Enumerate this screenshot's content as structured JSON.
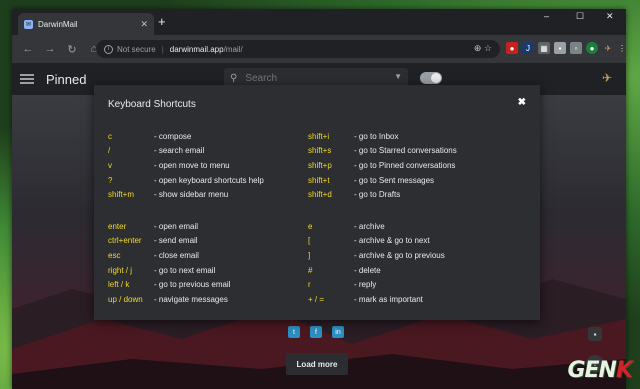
{
  "browser": {
    "tab_title": "DarwinMail",
    "new_tab": "+",
    "window_controls": [
      "–",
      "☐",
      "✕"
    ],
    "address": {
      "security": "Not secure",
      "host": "darwinmail.app",
      "path": "/mail/"
    },
    "extensions": [
      "J"
    ]
  },
  "app": {
    "title": "Pinned",
    "search_placeholder": "Search"
  },
  "modal": {
    "title": "Keyboard Shortcuts",
    "close": "✖",
    "left_top": [
      {
        "key": "c",
        "desc": "- compose"
      },
      {
        "key": "/",
        "desc": "- search email"
      },
      {
        "key": "v",
        "desc": "- open move to menu"
      },
      {
        "key": "?",
        "desc": "- open keyboard shortcuts help"
      },
      {
        "key": "shift+m",
        "desc": "- show sidebar menu"
      }
    ],
    "right_top": [
      {
        "key": "shift+i",
        "desc": "- go to Inbox"
      },
      {
        "key": "shift+s",
        "desc": "- go to Starred conversations"
      },
      {
        "key": "shift+p",
        "desc": "- go to Pinned conversations"
      },
      {
        "key": "shift+t",
        "desc": "- go to Sent messages"
      },
      {
        "key": "shift+d",
        "desc": "- go to Drafts"
      }
    ],
    "left_bottom": [
      {
        "key": "enter",
        "desc": "- open email"
      },
      {
        "key": "ctrl+enter",
        "desc": "- send email"
      },
      {
        "key": "esc",
        "desc": "- close email"
      },
      {
        "key": "right / j",
        "desc": "- go to next email"
      },
      {
        "key": "left / k",
        "desc": "- go to previous email"
      },
      {
        "key": "up / down",
        "desc": "- navigate messages"
      }
    ],
    "right_bottom": [
      {
        "key": "e",
        "desc": "- archive"
      },
      {
        "key": "[",
        "desc": "- archive & go to next"
      },
      {
        "key": "]",
        "desc": "- archive & go to previous"
      },
      {
        "key": "#",
        "desc": "- delete"
      },
      {
        "key": "r",
        "desc": "- reply"
      },
      {
        "key": "+ / =",
        "desc": "- mark as important"
      }
    ]
  },
  "footer": {
    "social": [
      "t",
      "f",
      "in"
    ],
    "load_more": "Load more"
  },
  "watermark": {
    "main": "GEN",
    "accent": "K"
  },
  "colors": {
    "shortcut_key": "#f1d92d",
    "modal_bg": "#2d2e31",
    "chrome_bg": "#202124",
    "social_blue": "#2d8fc1"
  }
}
